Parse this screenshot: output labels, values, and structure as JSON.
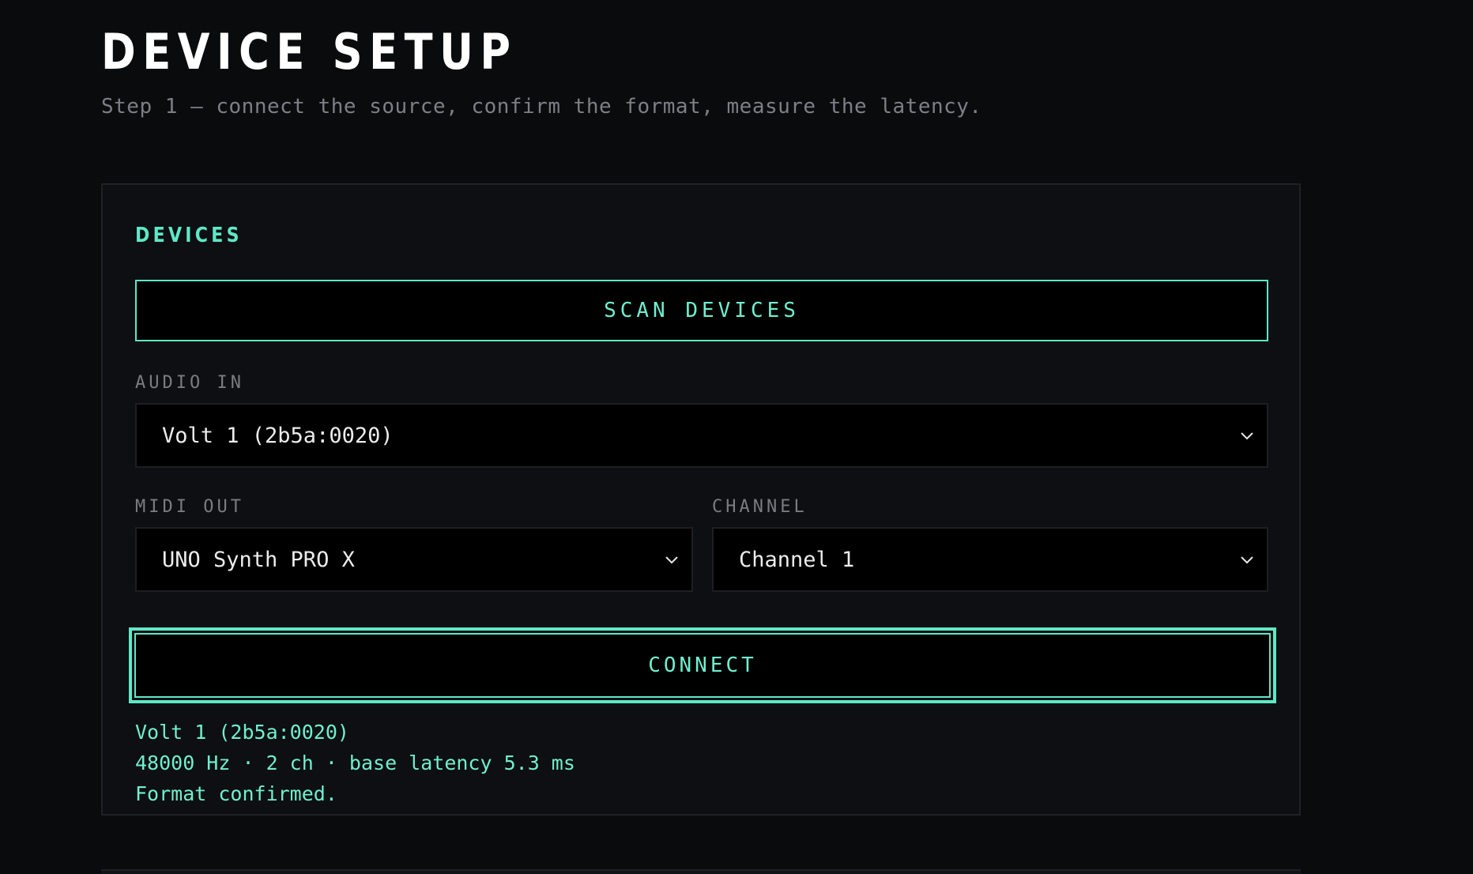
{
  "header": {
    "title": "DEVICE SETUP",
    "subtitle": "Step 1 — connect the source, confirm the format, measure the latency."
  },
  "devices_panel": {
    "heading": "DEVICES",
    "scan_label": "SCAN DEVICES",
    "audio_in": {
      "label": "AUDIO IN",
      "selected": "Volt 1 (2b5a:0020)",
      "icon": "chevron-down-icon"
    },
    "midi_out": {
      "label": "MIDI OUT",
      "selected": "UNO Synth PRO X",
      "icon": "chevron-down-icon"
    },
    "channel": {
      "label": "CHANNEL",
      "selected": "Channel 1",
      "icon": "chevron-down-icon"
    },
    "connect_label": "CONNECT",
    "status": {
      "device": "Volt 1 (2b5a:0020)",
      "format": "48000 Hz · 2 ch · base latency 5.3 ms",
      "message": "Format confirmed."
    }
  },
  "colors": {
    "background": "#0a0b0d",
    "panel": "#0e0f12",
    "accent": "#5ee8c6",
    "muted_text": "#7d7f86"
  }
}
